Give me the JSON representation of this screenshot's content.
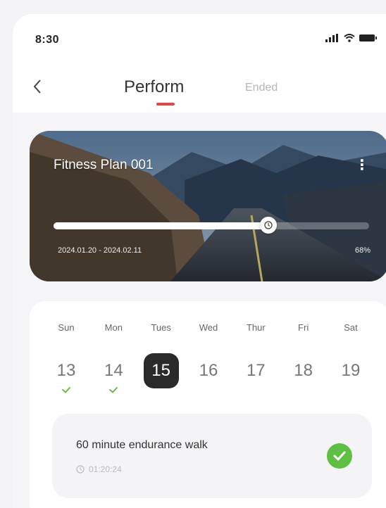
{
  "status": {
    "time": "8:30"
  },
  "nav": {
    "tab_active": "Perform",
    "tab_ended": "Ended"
  },
  "plan": {
    "title": "Fitness Plan 001",
    "dates": "2024.01.20 - 2024.02.11",
    "percent_label": "68%",
    "progress": 0.68
  },
  "week": {
    "days": [
      {
        "name": "Sun",
        "num": "13",
        "done": true
      },
      {
        "name": "Mon",
        "num": "14",
        "done": true
      },
      {
        "name": "Tues",
        "num": "15",
        "done": false
      },
      {
        "name": "Wed",
        "num": "16",
        "done": false
      },
      {
        "name": "Thur",
        "num": "17",
        "done": false
      },
      {
        "name": "Fri",
        "num": "18",
        "done": false
      },
      {
        "name": "Sat",
        "num": "19",
        "done": false
      }
    ],
    "selected_index": 2
  },
  "task": {
    "title": "60 minute endurance walk",
    "time": "01:20:24",
    "status_icon": "check-circle-icon"
  },
  "colors": {
    "accent": "#e74545",
    "done": "#5fbf42",
    "selected_day": "#2a2a2a"
  }
}
